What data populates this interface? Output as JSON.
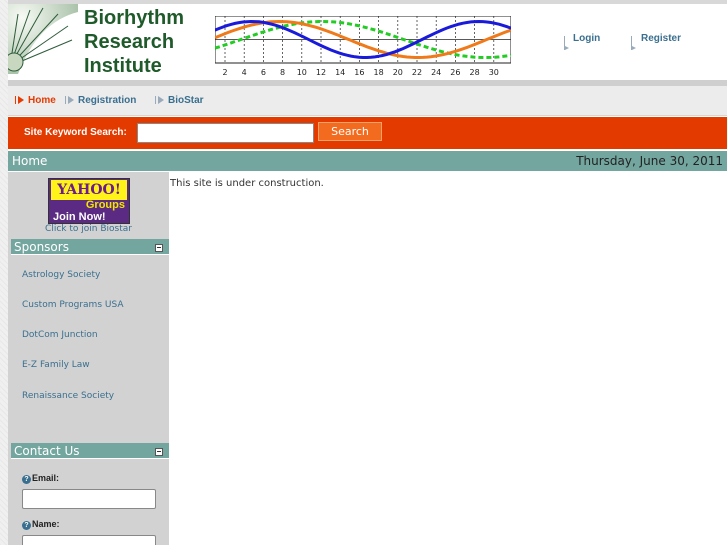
{
  "header": {
    "brand_lines": [
      "Biorhythm",
      "Research",
      "Institute"
    ],
    "wave_axis_ticks": [
      "2",
      "4",
      "6",
      "8",
      "10",
      "12",
      "14",
      "16",
      "18",
      "20",
      "22",
      "24",
      "26",
      "28",
      "30"
    ],
    "wave_colors": {
      "physical": "#1a1adb",
      "emotional": "#f07a1a",
      "intellectual": "#22cc22"
    },
    "login_label": "Login",
    "register_label": "Register"
  },
  "nav": {
    "items": [
      {
        "label": "Home",
        "active": true
      },
      {
        "label": "Registration",
        "active": false
      },
      {
        "label": "BioStar",
        "active": false
      }
    ]
  },
  "search": {
    "label": "Site Keyword Search:",
    "input_value": "",
    "button_label": "Search"
  },
  "crumbbar": {
    "current": "Home",
    "date": "Thursday, June 30, 2011"
  },
  "sidebar": {
    "yahoo": {
      "logo": "YAHOO!",
      "sub": "Groups",
      "join": "Join Now!"
    },
    "click_to_join": "Click to join Biostar",
    "sponsors_title": "Sponsors",
    "sponsors": [
      "Astrology Society",
      "Custom Programs USA",
      "DotCom Junction",
      "E-Z Family Law",
      "Renaissance Society"
    ],
    "contact_title": "Contact Us",
    "email_label": "Email:",
    "email_value": "",
    "name_label": "Name:",
    "name_value": ""
  },
  "main": {
    "message": "This site is under construction."
  },
  "colors": {
    "accent_red": "#e33a00",
    "teal": "#74a6a0",
    "brand_green": "#1f5a2a",
    "link_blue": "#3a6f8f"
  }
}
